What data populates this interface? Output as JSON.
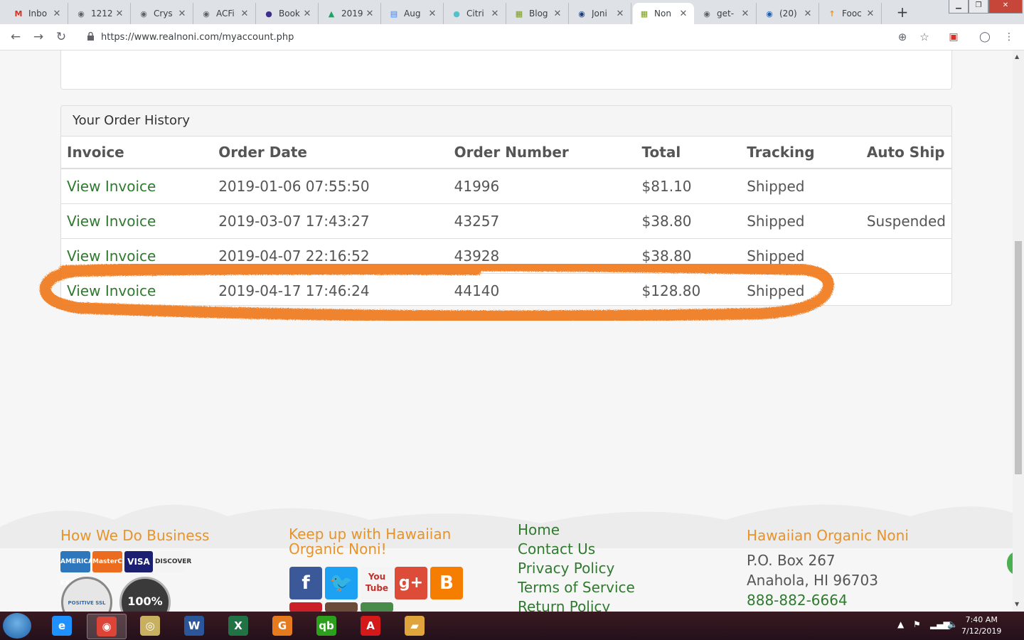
{
  "browser": {
    "tabs": [
      {
        "title": "Inbo",
        "icon": "gmail-icon",
        "color": "#d93025",
        "glyph": "M"
      },
      {
        "title": "1212",
        "icon": "globe-icon",
        "color": "#5f6368",
        "glyph": "◉"
      },
      {
        "title": "Crys",
        "icon": "globe-icon",
        "color": "#5f6368",
        "glyph": "◉"
      },
      {
        "title": "ACFi",
        "icon": "globe-icon",
        "color": "#5f6368",
        "glyph": "◉"
      },
      {
        "title": "Book",
        "icon": "book-icon",
        "color": "#3b2e8c",
        "glyph": "●"
      },
      {
        "title": "2019",
        "icon": "drive-icon",
        "color": "#1ea362",
        "glyph": "▲"
      },
      {
        "title": "Aug",
        "icon": "docs-icon",
        "color": "#4285f4",
        "glyph": "▤"
      },
      {
        "title": "Citri",
        "icon": "citrix-icon",
        "color": "#4fc3c7",
        "glyph": "●"
      },
      {
        "title": "Blog",
        "icon": "noni-leaf-icon",
        "color": "#7a9b1c",
        "glyph": "▦"
      },
      {
        "title": "Joni",
        "icon": "site-icon",
        "color": "#1a3d7c",
        "glyph": "◉"
      },
      {
        "title": "Non",
        "icon": "noni-leaf-icon",
        "color": "#7a9b1c",
        "glyph": "▦"
      },
      {
        "title": "get-",
        "icon": "globe-icon",
        "color": "#5f6368",
        "glyph": "◉"
      },
      {
        "title": "(20)",
        "icon": "chat-icon",
        "color": "#1a5fb4",
        "glyph": "◉"
      },
      {
        "title": "Fooc",
        "icon": "pin-icon",
        "color": "#e8932a",
        "glyph": "↑"
      }
    ],
    "active_tab": 10,
    "url": "https://www.realnoni.com/myaccount.php"
  },
  "orders": {
    "heading": "Your Order History",
    "columns": [
      "Invoice",
      "Order Date",
      "Order Number",
      "Total",
      "Tracking",
      "Auto Ship"
    ],
    "rows": [
      {
        "invoice": "View Invoice",
        "date": "2019-01-06 07:55:50",
        "number": "41996",
        "total": "$81.10",
        "tracking": "Shipped",
        "autoship": ""
      },
      {
        "invoice": "View Invoice",
        "date": "2019-03-07 17:43:27",
        "number": "43257",
        "total": "$38.80",
        "tracking": "Shipped",
        "autoship": "Suspended"
      },
      {
        "invoice": "View Invoice",
        "date": "2019-04-07 22:16:52",
        "number": "43928",
        "total": "$38.80",
        "tracking": "Shipped",
        "autoship": ""
      },
      {
        "invoice": "View Invoice",
        "date": "2019-04-17 17:46:24",
        "number": "44140",
        "total": "$128.80",
        "tracking": "Shipped",
        "autoship": ""
      }
    ],
    "highlight_color": "#f07a1a"
  },
  "footer": {
    "business_heading": "How We Do Business",
    "social_heading": "Keep up with Hawaiian Organic Noni!",
    "links": [
      "Home",
      "Contact Us",
      "Privacy Policy",
      "Terms of Service",
      "Return Policy"
    ],
    "company_heading": "Hawaiian Organic Noni",
    "address_line1": "P.O. Box 267",
    "address_line2": "Anahola, HI 96703",
    "phone": "888-882-6664",
    "cards": [
      "AMERICAN EXPRESS",
      "MasterCard",
      "VISA",
      "DISCOVER"
    ],
    "badge_text": "100%",
    "ssl_text": "POSITIVE SSL",
    "accent": "#e8932a",
    "link_color": "#2f7a2f"
  },
  "taskbar": {
    "apps": [
      {
        "name": "internet-explorer",
        "glyph": "e",
        "color": "#1e90ff"
      },
      {
        "name": "chrome",
        "glyph": "◉",
        "color": "#db4437"
      },
      {
        "name": "app-wifi-tool",
        "glyph": "◎",
        "color": "#c8b060"
      },
      {
        "name": "word",
        "glyph": "W",
        "color": "#2b579a"
      },
      {
        "name": "excel",
        "glyph": "X",
        "color": "#217346"
      },
      {
        "name": "pdf-tool",
        "glyph": "G",
        "color": "#e57a1e"
      },
      {
        "name": "quickbooks",
        "glyph": "qb",
        "color": "#2ca01c"
      },
      {
        "name": "acrobat",
        "glyph": "A",
        "color": "#d4191b"
      },
      {
        "name": "book-app",
        "glyph": "▰",
        "color": "#e0a43c"
      }
    ],
    "time": "7:40 AM",
    "date": "7/12/2019"
  }
}
